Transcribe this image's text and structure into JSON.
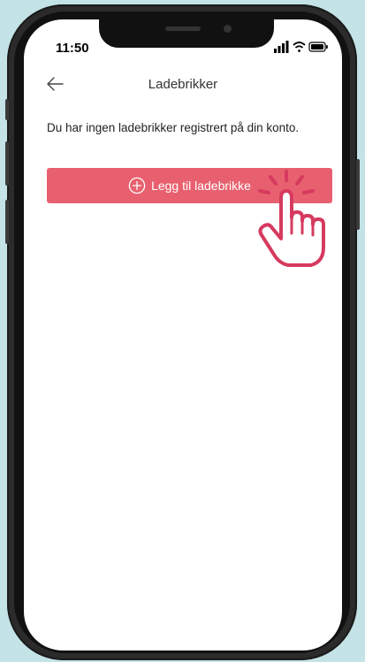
{
  "status_bar": {
    "time": "11:50"
  },
  "header": {
    "title": "Ladebrikker"
  },
  "main": {
    "empty_message": "Du har ingen ladebrikker registrert på din konto.",
    "add_button_label": "Legg til ladebrikke"
  },
  "icons": {
    "back": "back-arrow-icon",
    "add": "plus-circle-icon",
    "pointer": "tap-hand-icon"
  },
  "colors": {
    "accent": "#e8606f",
    "pointer": "#d63a5f",
    "background": "#c3e3e6"
  }
}
